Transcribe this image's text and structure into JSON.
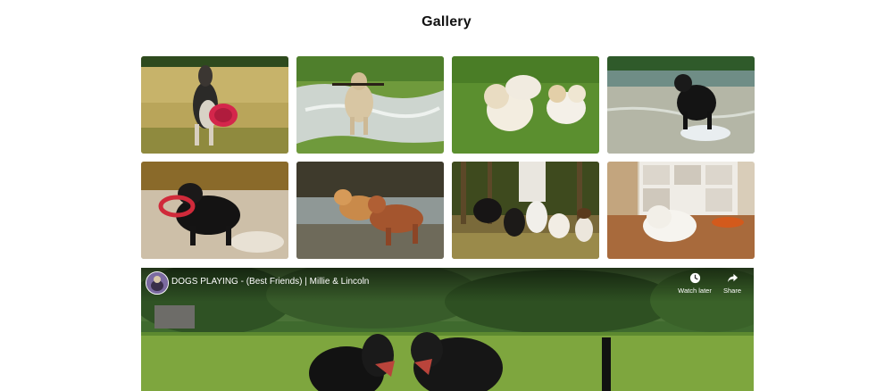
{
  "page": {
    "title": "Gallery"
  },
  "gallery": {
    "items": [
      {
        "alt": "Dog catching a red frisbee on grass",
        "icon": "dog-frisbee-photo"
      },
      {
        "alt": "Labrador running through puddle with stick",
        "icon": "dog-puddle-photo"
      },
      {
        "alt": "Two fluffy white dogs on a lawn",
        "icon": "white-dogs-photo"
      },
      {
        "alt": "Black dog splashing in a river",
        "icon": "black-dog-river-photo"
      },
      {
        "alt": "Black dog with red ring toy in water",
        "icon": "dog-ring-water-photo"
      },
      {
        "alt": "Two brown dogs running together",
        "icon": "brown-dogs-running-photo"
      },
      {
        "alt": "Group of dogs on leashes in a forest",
        "icon": "dog-pack-forest-photo"
      },
      {
        "alt": "White puppy on a wooden floor",
        "icon": "white-puppy-photo"
      }
    ]
  },
  "video": {
    "title": "DOGS PLAYING - (Best Friends) | Millie & Lincoln",
    "watch_later_label": "Watch later",
    "share_label": "Share",
    "icons": {
      "channel": "channel-avatar-icon",
      "watch_later": "clock-icon",
      "share": "share-arrow-icon"
    }
  },
  "colors": {
    "title": "#111111",
    "grass": "#5f8f32",
    "background": "#ffffff"
  }
}
